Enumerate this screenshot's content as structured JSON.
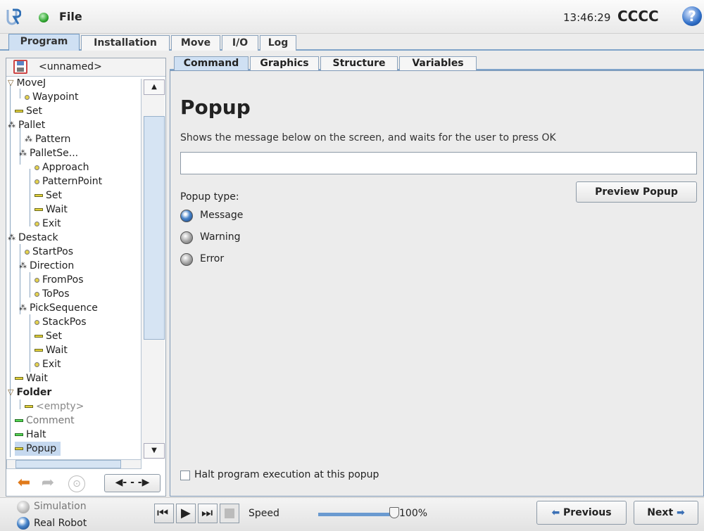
{
  "header": {
    "menu_file": "File",
    "clock": "13:46:29",
    "robot_name": "CCCC",
    "status_color": "#2fa52f"
  },
  "main_tabs": [
    "Program",
    "Installation",
    "Move",
    "I/O",
    "Log"
  ],
  "program": {
    "filename": "<unnamed>"
  },
  "tree": [
    {
      "label": "MoveJ",
      "icon": "triangle-icon"
    },
    {
      "label": "Waypoint",
      "icon": "waypoint-icon"
    },
    {
      "label": "Set",
      "icon": "command-icon"
    },
    {
      "label": "Pallet",
      "icon": "pallet-icon"
    },
    {
      "label": "Pattern",
      "icon": "pallet-icon"
    },
    {
      "label": "PalletSe...",
      "icon": "pallet-icon"
    },
    {
      "label": "Approach",
      "icon": "waypoint-icon"
    },
    {
      "label": "PatternPoint",
      "icon": "waypoint-icon"
    },
    {
      "label": "Set",
      "icon": "command-icon"
    },
    {
      "label": "Wait",
      "icon": "command-icon"
    },
    {
      "label": "Exit",
      "icon": "waypoint-icon"
    },
    {
      "label": "Destack",
      "icon": "pallet-icon"
    },
    {
      "label": "StartPos",
      "icon": "waypoint-icon"
    },
    {
      "label": "Direction",
      "icon": "pallet-icon"
    },
    {
      "label": "FromPos",
      "icon": "waypoint-icon"
    },
    {
      "label": "ToPos",
      "icon": "waypoint-icon"
    },
    {
      "label": "PickSequence",
      "icon": "pallet-icon"
    },
    {
      "label": "StackPos",
      "icon": "waypoint-icon"
    },
    {
      "label": "Set",
      "icon": "command-icon"
    },
    {
      "label": "Wait",
      "icon": "command-icon"
    },
    {
      "label": "Exit",
      "icon": "waypoint-icon"
    },
    {
      "label": "Wait",
      "icon": "command-icon"
    },
    {
      "label": "Folder",
      "icon": "triangle-icon"
    },
    {
      "label": "<empty>",
      "icon": "command-icon"
    },
    {
      "label": "Comment",
      "icon": "command-icon"
    },
    {
      "label": "Halt",
      "icon": "command-icon"
    },
    {
      "label": "Popup",
      "icon": "command-icon"
    }
  ],
  "subtabs": [
    "Command",
    "Graphics",
    "Structure",
    "Variables"
  ],
  "popup": {
    "title": "Popup",
    "description": "Shows the message below on the screen, and waits for the user to press OK",
    "message_value": "",
    "preview_button": "Preview Popup",
    "type_label": "Popup type:",
    "types": [
      {
        "label": "Message",
        "selected": true
      },
      {
        "label": "Warning",
        "selected": false
      },
      {
        "label": "Error",
        "selected": false
      }
    ],
    "halt_checkbox_label": "Halt program execution at this popup",
    "halt_checked": false
  },
  "footer": {
    "simulation": "Simulation",
    "real_robot": "Real Robot",
    "speed_label": "Speed",
    "speed_value": "100%",
    "speed_fraction": 1.0,
    "previous": "Previous",
    "next": "Next"
  }
}
